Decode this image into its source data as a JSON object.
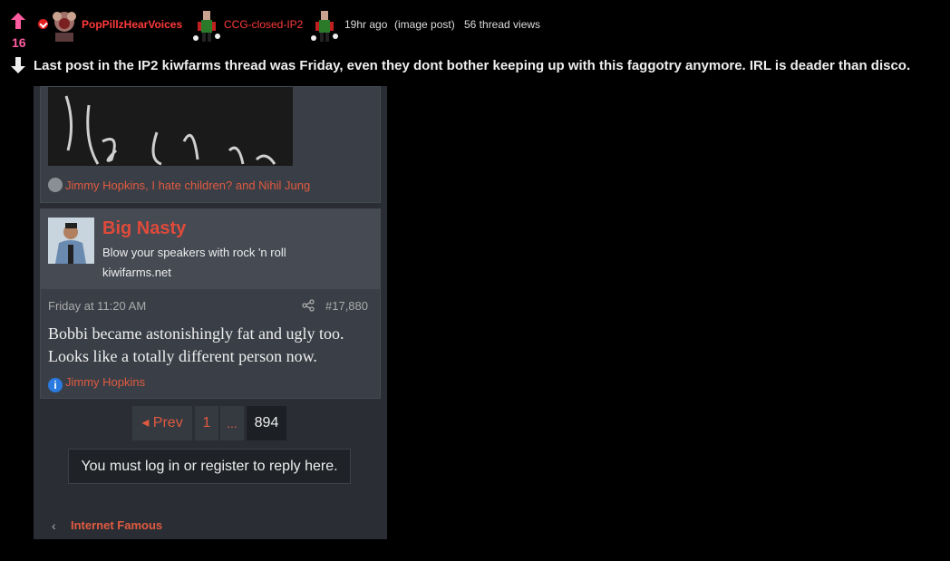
{
  "post": {
    "score": "16",
    "username": "PopPillzHearVoices",
    "board": "CCG-closed-IP2",
    "time_ago": "19hr ago",
    "post_type": "(image post)",
    "views": "56 thread views",
    "title": "Last post in the IP2 kiwfarms thread was Friday, even they dont bother keeping up with this faggotry anymore. IRL is deader than disco."
  },
  "screenshot": {
    "prev_reactions": "Jimmy Hopkins, I hate children? and Nihil Jung",
    "author": {
      "name": "Big Nasty",
      "title": "Blow your speakers with rock 'n roll",
      "site": "kiwifarms.net"
    },
    "post_date": "Friday at 11:20 AM",
    "post_number": "#17,880",
    "post_body": "Bobbi became astonishingly fat and ugly too. Looks like a totally different person now.",
    "post_reaction": "Jimmy Hopkins",
    "pagination": {
      "prev": "◂ Prev",
      "first": "1",
      "dots": "...",
      "current": "894"
    },
    "login_prompt": "You must log in or register to reply here.",
    "breadcrumb": "Internet Famous"
  },
  "colors": {
    "accent": "#e05a40",
    "username": "#ff3a3a",
    "score": "#ff5ca0"
  }
}
